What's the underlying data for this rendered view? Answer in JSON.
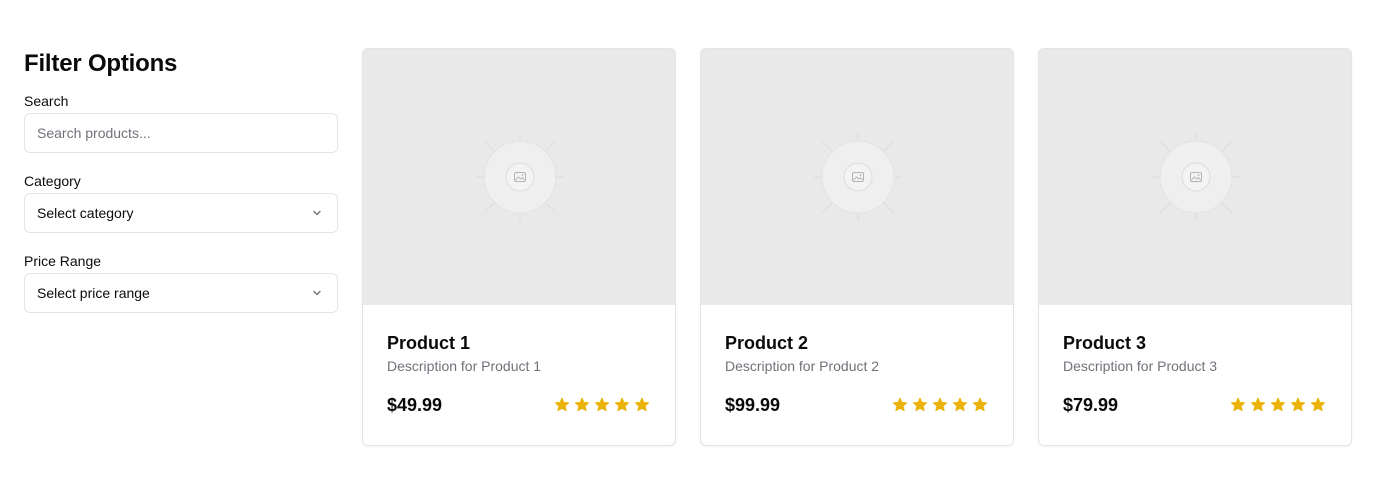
{
  "sidebar": {
    "title": "Filter Options",
    "search": {
      "label": "Search",
      "placeholder": "Search products...",
      "value": ""
    },
    "category": {
      "label": "Category",
      "value": "Select category"
    },
    "price_range": {
      "label": "Price Range",
      "value": "Select price range"
    }
  },
  "products": [
    {
      "title": "Product 1",
      "description": "Description for Product 1",
      "price": "$49.99",
      "rating": 5
    },
    {
      "title": "Product 2",
      "description": "Description for Product 2",
      "price": "$99.99",
      "rating": 5
    },
    {
      "title": "Product 3",
      "description": "Description for Product 3",
      "price": "$79.99",
      "rating": 5
    }
  ],
  "colors": {
    "star": "#eab308",
    "muted_text": "#71717a",
    "border": "#e4e4e7",
    "image_placeholder": "#e9e9e9"
  },
  "icons": {
    "select": "chevron-down-icon",
    "rating": "star-icon",
    "image": "image-placeholder-icon"
  }
}
